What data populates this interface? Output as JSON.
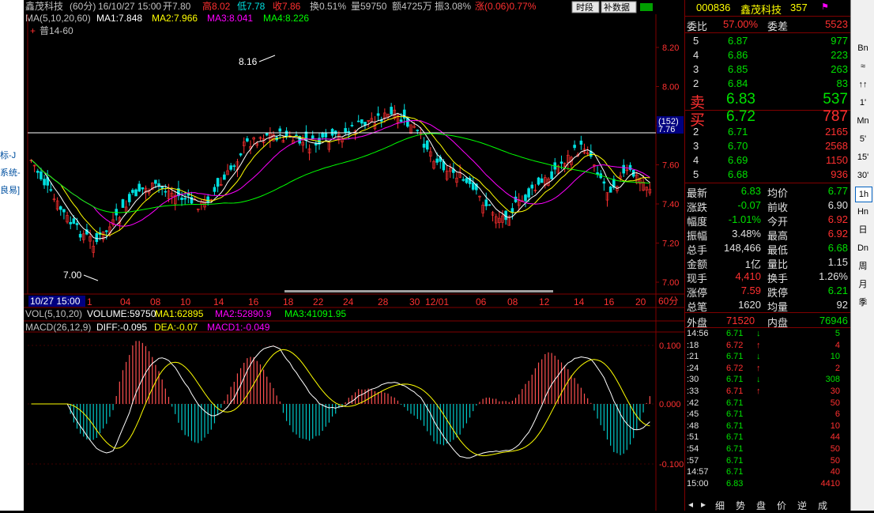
{
  "left_strip": [
    "标-J",
    "系统-",
    "良易]"
  ],
  "header": {
    "name": "鑫茂科技",
    "period": "(60分)",
    "datetime": "16/10/27 15:00",
    "open": "开7.80",
    "high": "高8.02",
    "low": "低7.78",
    "close": "收7.86",
    "turnover": "换0.51%",
    "volume": "量59750",
    "amount": "额4725万",
    "amplitude": "振3.08%",
    "change": "涨(0.06)0.77%",
    "btn_timeshare": "时段",
    "btn_supplement": "补数据"
  },
  "ma_line": {
    "label": "MA(5,10,20,60)",
    "ma1": "MA1:7.848",
    "ma2": "MA2:7.966",
    "ma3": "MA3:8.041",
    "ma4": "MA4:8.226"
  },
  "legend_sub": "普14-60",
  "price_axis": [
    "8.20",
    "8.00",
    "7.80",
    "7.60",
    "7.40",
    "7.20",
    "7.00"
  ],
  "price_marker": {
    "count": "(152)",
    "value": "7.76"
  },
  "annotations": {
    "high": "8.16",
    "low": "7.00"
  },
  "date_axis": {
    "cursor": "10/27 15:00",
    "labels": [
      "04",
      "08",
      "10",
      "14",
      "16",
      "18",
      "22",
      "24",
      "28",
      "30",
      "12/01",
      "06",
      "08",
      "12",
      "14",
      "16",
      "20"
    ],
    "first": "1",
    "period": "60分"
  },
  "volume_line": {
    "label": "VOL(5,10,20)",
    "volume": "VOLUME:59750",
    "ma1": "MA1:62895",
    "ma2": "MA2:52890.9",
    "ma3": "MA3:41091.95"
  },
  "macd_line": {
    "label": "MACD(26,12,9)",
    "diff": "DIFF:-0.095",
    "dea": "DEA:-0.07",
    "macd": "MACD1:-0.049"
  },
  "macd_axis": [
    "0.100",
    "0.000",
    "-0.100"
  ],
  "colors": {
    "up": "#ff3030",
    "down": "#00e0e0",
    "ma1": "#ffffff",
    "ma2": "#ffff00",
    "ma3": "#ff00ff",
    "ma4": "#00ff00"
  },
  "quote": {
    "code": "000836",
    "name": "鑫茂科技",
    "num": "357",
    "ratio_label": "委比",
    "ratio": "57.00%",
    "diff_label": "委差",
    "diff": "5523",
    "sell_levels": [
      {
        "lvl": "5",
        "price": "6.87",
        "vol": "977"
      },
      {
        "lvl": "4",
        "price": "6.86",
        "vol": "223"
      },
      {
        "lvl": "3",
        "price": "6.85",
        "vol": "263"
      },
      {
        "lvl": "2",
        "price": "6.84",
        "vol": "83"
      }
    ],
    "sell1": {
      "label": "卖",
      "price": "6.83",
      "vol": "537"
    },
    "buy1": {
      "label": "买",
      "price": "6.72",
      "vol": "787"
    },
    "buy_levels": [
      {
        "lvl": "2",
        "price": "6.71",
        "vol": "2165"
      },
      {
        "lvl": "3",
        "price": "6.70",
        "vol": "2568"
      },
      {
        "lvl": "4",
        "price": "6.69",
        "vol": "1150"
      },
      {
        "lvl": "5",
        "price": "6.68",
        "vol": "936"
      }
    ],
    "stats": [
      {
        "l1": "最新",
        "v1": "6.83",
        "c1": "green",
        "l2": "均价",
        "v2": "6.77",
        "c2": "green"
      },
      {
        "l1": "涨跌",
        "v1": "-0.07",
        "c1": "green",
        "l2": "前收",
        "v2": "6.90",
        "c2": "white"
      },
      {
        "l1": "幅度",
        "v1": "-1.01%",
        "c1": "green",
        "l2": "今开",
        "v2": "6.92",
        "c2": "red"
      },
      {
        "l1": "振幅",
        "v1": "3.48%",
        "c1": "white",
        "l2": "最高",
        "v2": "6.92",
        "c2": "red"
      },
      {
        "l1": "总手",
        "v1": "148,466",
        "c1": "white",
        "l2": "最低",
        "v2": "6.68",
        "c2": "green"
      },
      {
        "l1": "金额",
        "v1": "1亿",
        "c1": "white",
        "l2": "量比",
        "v2": "1.15",
        "c2": "white"
      },
      {
        "l1": "现手",
        "v1": "4,410",
        "c1": "red",
        "l2": "换手",
        "v2": "1.26%",
        "c2": "white"
      },
      {
        "l1": "涨停",
        "v1": "7.59",
        "c1": "red",
        "l2": "跌停",
        "v2": "6.21",
        "c2": "green"
      },
      {
        "l1": "总笔",
        "v1": "1620",
        "c1": "white",
        "l2": "均量",
        "v2": "92",
        "c2": "white"
      }
    ],
    "outer_label": "外盘",
    "outer": "71520",
    "inner_label": "内盘",
    "inner": "76946",
    "ticks": [
      {
        "t": "14:56",
        "p": "6.71",
        "d": "↓",
        "v": "5",
        "c": "green"
      },
      {
        "t": ":18",
        "p": "6.72",
        "d": "↑",
        "v": "4",
        "c": "red"
      },
      {
        "t": ":21",
        "p": "6.71",
        "d": "↓",
        "v": "10",
        "c": "green"
      },
      {
        "t": ":24",
        "p": "6.72",
        "d": "↑",
        "v": "2",
        "c": "red"
      },
      {
        "t": ":30",
        "p": "6.71",
        "d": "↓",
        "v": "308",
        "c": "green"
      },
      {
        "t": ":33",
        "p": "6.71",
        "d": "↑",
        "v": "30",
        "c": "red"
      },
      {
        "t": ":42",
        "p": "6.71",
        "d": "",
        "v": "50",
        "c": "red"
      },
      {
        "t": ":45",
        "p": "6.71",
        "d": "",
        "v": "6",
        "c": "red"
      },
      {
        "t": ":48",
        "p": "6.71",
        "d": "",
        "v": "10",
        "c": "red"
      },
      {
        "t": ":51",
        "p": "6.71",
        "d": "",
        "v": "44",
        "c": "red"
      },
      {
        "t": ":54",
        "p": "6.71",
        "d": "",
        "v": "50",
        "c": "red"
      },
      {
        "t": ":57",
        "p": "6.71",
        "d": "",
        "v": "50",
        "c": "red"
      },
      {
        "t": "14:57",
        "p": "6.71",
        "d": "",
        "v": "40",
        "c": "red"
      },
      {
        "t": "15:00",
        "p": "6.83",
        "d": "",
        "v": "4410",
        "c": "red"
      }
    ],
    "tabs": [
      "细",
      "势",
      "盘",
      "价",
      "逆",
      "成"
    ]
  },
  "toolbar": [
    "Bn",
    "≈",
    "↑↑",
    "1'",
    "Mn",
    "5'",
    "15'",
    "30'",
    "1h",
    "Hn",
    "日",
    "Dn",
    "周",
    "月",
    "季"
  ]
}
